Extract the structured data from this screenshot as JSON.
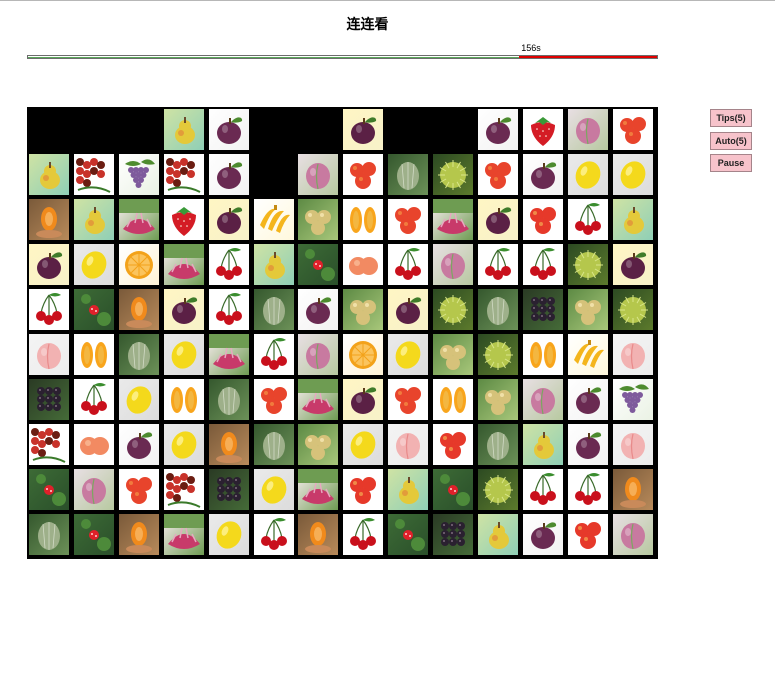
{
  "title": "连连看",
  "timer": {
    "label": "156s",
    "remaining_fraction": 0.22
  },
  "buttons": {
    "tips": "Tips(5)",
    "auto": "Auto(5)",
    "pause": "Pause"
  },
  "fruit_palette": {
    "empty": {
      "bg": "#000000"
    },
    "pear": {
      "bg": "#cfe3a4",
      "bg2": "#8fcfb6",
      "fg": "#e4c93a",
      "accent": "#e06f3a"
    },
    "plum": {
      "bg": "#fff6c4",
      "bg2": "#f7f1c9",
      "fg": "#5b2045",
      "accent": "#3f7b2a"
    },
    "plum_white": {
      "bg": "#ffffff",
      "bg2": "#f2f2f2",
      "fg": "#6a2a52",
      "accent": "#4c8a2e"
    },
    "strawberry": {
      "bg": "#ffffff",
      "bg2": "#ffffff",
      "fg": "#d41c25",
      "accent": "#3a9a38"
    },
    "peach": {
      "bg": "#e8dfe3",
      "bg2": "#b7c9a0",
      "fg": "#c87aa0",
      "accent": "#7aa860"
    },
    "lychee_pile": {
      "bg": "#ffffff",
      "bg2": "#ffffff",
      "fg": "#c8322a",
      "accent": "#6b1d12"
    },
    "lemon": {
      "bg": "#eaeaea",
      "bg2": "#dcdcdc",
      "fg": "#f4d91c",
      "accent": "#d8b615"
    },
    "mango_slice": {
      "bg": "#ffffff",
      "bg2": "#ffffff",
      "fg": "#f8a51c",
      "accent": "#f0c35a"
    },
    "berries_green": {
      "bg": "#3d6b36",
      "bg2": "#2a4f2a",
      "fg": "#e0202a",
      "accent": "#6db05e"
    },
    "grapes": {
      "bg": "#ffffff",
      "bg2": "#eaf2e4",
      "fg": "#7e5a9c",
      "accent": "#4e8c2e"
    },
    "chestnut": {
      "bg": "#2c4a22",
      "bg2": "#5c7a2c",
      "fg": "#b5c74c",
      "accent": "#d9e68a"
    },
    "melon": {
      "bg": "#35582e",
      "bg2": "#6c9158",
      "fg": "#9eb08a",
      "accent": "#e7ecde"
    },
    "cherries": {
      "bg": "#ffffff",
      "bg2": "#ffffff",
      "fg": "#c9101c",
      "accent": "#3a8d2e"
    },
    "papaya": {
      "bg": "#7a5a3a",
      "bg2": "#b88a5a",
      "fg": "#f08a1c",
      "accent": "#fbd290"
    },
    "banana": {
      "bg": "#ffffff",
      "bg2": "#fff8dc",
      "fg": "#f4b51c",
      "accent": "#c58a12"
    },
    "nectarine": {
      "bg": "#ffffff",
      "bg2": "#ffffff",
      "fg": "#e8442c",
      "accent": "#f6a04a"
    },
    "blackberry": {
      "bg": "#2a3a24",
      "bg2": "#456b38",
      "fg": "#2a2030",
      "accent": "#7c6b7c"
    },
    "peach_pink": {
      "bg": "#f4f4f4",
      "bg2": "#ececec",
      "fg": "#f2b2b2",
      "accent": "#e88a8a"
    },
    "longan": {
      "bg": "#5d8a44",
      "bg2": "#a8c77a",
      "fg": "#d6c27a",
      "accent": "#f0e0a8"
    },
    "orange_slice": {
      "bg": "#ffffff",
      "bg2": "#ffffff",
      "fg": "#f59a14",
      "accent": "#fbd35a"
    },
    "peach_fuzzy": {
      "bg": "#ffffff",
      "bg2": "#ffffff",
      "fg": "#f28a62",
      "accent": "#fbc29e"
    },
    "dragon": {
      "bg": "#fbeef2",
      "bg2": "#6e9c52",
      "fg": "#c83a6a",
      "accent": "#e7a8c0"
    },
    "orange_half": {
      "bg": "#ffffff",
      "bg2": "#fff3d6",
      "fg": "#f3a21a",
      "accent": "#fdd37a"
    },
    "redapple": {
      "bg": "#ffffff",
      "bg2": "#ffffff",
      "fg": "#e6392a",
      "accent": "#f7c05a"
    }
  },
  "board": {
    "cols": 14,
    "rows": 10,
    "tiles": [
      [
        "empty",
        "empty",
        "empty",
        "pear",
        "plum_white",
        "empty",
        "empty",
        "plum",
        "empty",
        "empty",
        "plum_white",
        "strawberry",
        "peach",
        "nectarine"
      ],
      [
        "pear",
        "lychee_pile",
        "grapes",
        "lychee_pile",
        "plum_white",
        "empty",
        "peach",
        "nectarine",
        "melon",
        "chestnut",
        "nectarine",
        "plum_white",
        "lemon",
        "lemon"
      ],
      [
        "papaya",
        "pear",
        "dragon",
        "strawberry",
        "plum",
        "banana",
        "longan",
        "mango_slice",
        "nectarine",
        "dragon",
        "plum",
        "redapple",
        "cherries",
        "pear"
      ],
      [
        "plum",
        "lemon",
        "orange_half",
        "dragon",
        "cherries",
        "pear",
        "berries_green",
        "peach_fuzzy",
        "cherries",
        "peach",
        "cherries",
        "cherries",
        "chestnut",
        "plum"
      ],
      [
        "cherries",
        "berries_green",
        "papaya",
        "plum",
        "cherries",
        "melon",
        "plum_white",
        "longan",
        "plum",
        "chestnut",
        "melon",
        "blackberry",
        "longan",
        "chestnut"
      ],
      [
        "peach_pink",
        "mango_slice",
        "melon",
        "lemon",
        "dragon",
        "cherries",
        "peach",
        "orange_half",
        "lemon",
        "longan",
        "chestnut",
        "mango_slice",
        "banana",
        "peach_pink"
      ],
      [
        "blackberry",
        "cherries",
        "lemon",
        "mango_slice",
        "melon",
        "nectarine",
        "dragon",
        "plum",
        "nectarine",
        "mango_slice",
        "longan",
        "peach",
        "plum_white",
        "grapes"
      ],
      [
        "lychee_pile",
        "peach_fuzzy",
        "plum_white",
        "lemon",
        "papaya",
        "melon",
        "longan",
        "lemon",
        "peach_pink",
        "redapple",
        "melon",
        "pear",
        "plum_white",
        "peach_pink"
      ],
      [
        "berries_green",
        "peach",
        "nectarine",
        "lychee_pile",
        "blackberry",
        "lemon",
        "dragon",
        "redapple",
        "pear",
        "berries_green",
        "chestnut",
        "cherries",
        "cherries",
        "papaya"
      ],
      [
        "melon",
        "berries_green",
        "papaya",
        "dragon",
        "lemon",
        "cherries",
        "papaya",
        "cherries",
        "berries_green",
        "blackberry",
        "pear",
        "plum_white",
        "redapple",
        "peach"
      ]
    ]
  }
}
